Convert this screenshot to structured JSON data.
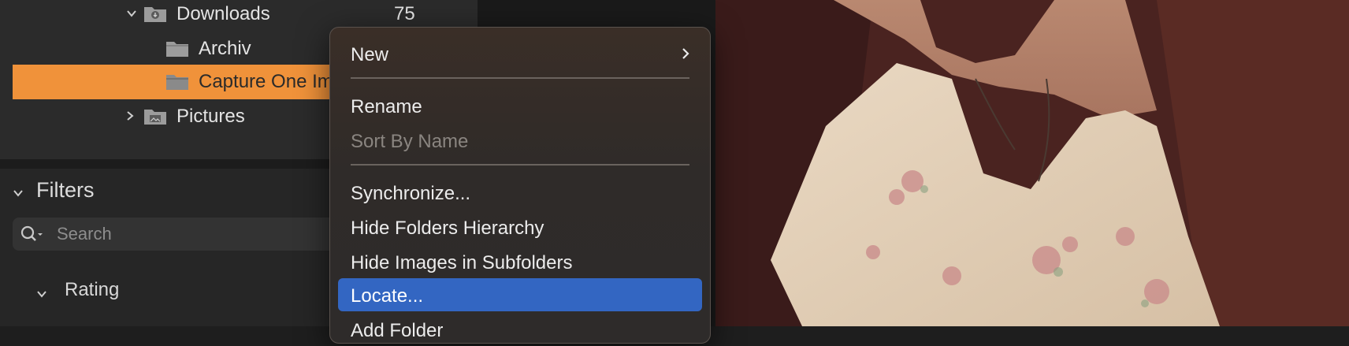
{
  "sidebar": {
    "tree": [
      {
        "name": "Downloads",
        "count": "75",
        "expanded": true
      },
      {
        "name": "Archiv"
      },
      {
        "name": "Capture One Im",
        "selected": true
      },
      {
        "name": "Pictures",
        "expanded": false
      }
    ],
    "filters": {
      "title": "Filters",
      "search_placeholder": "Search",
      "rating_label": "Rating"
    }
  },
  "context_menu": {
    "items": [
      {
        "label": "New",
        "submenu": true
      },
      {
        "label": "Rename"
      },
      {
        "label": "Sort By Name",
        "disabled": true
      },
      {
        "label": "Synchronize..."
      },
      {
        "label": "Hide Folders Hierarchy"
      },
      {
        "label": "Hide Images in Subfolders"
      },
      {
        "label": "Locate...",
        "highlighted": true
      },
      {
        "label": "Add Folder"
      }
    ]
  },
  "colors": {
    "selection": "#f0923a",
    "menu_highlight": "#3366c2"
  }
}
